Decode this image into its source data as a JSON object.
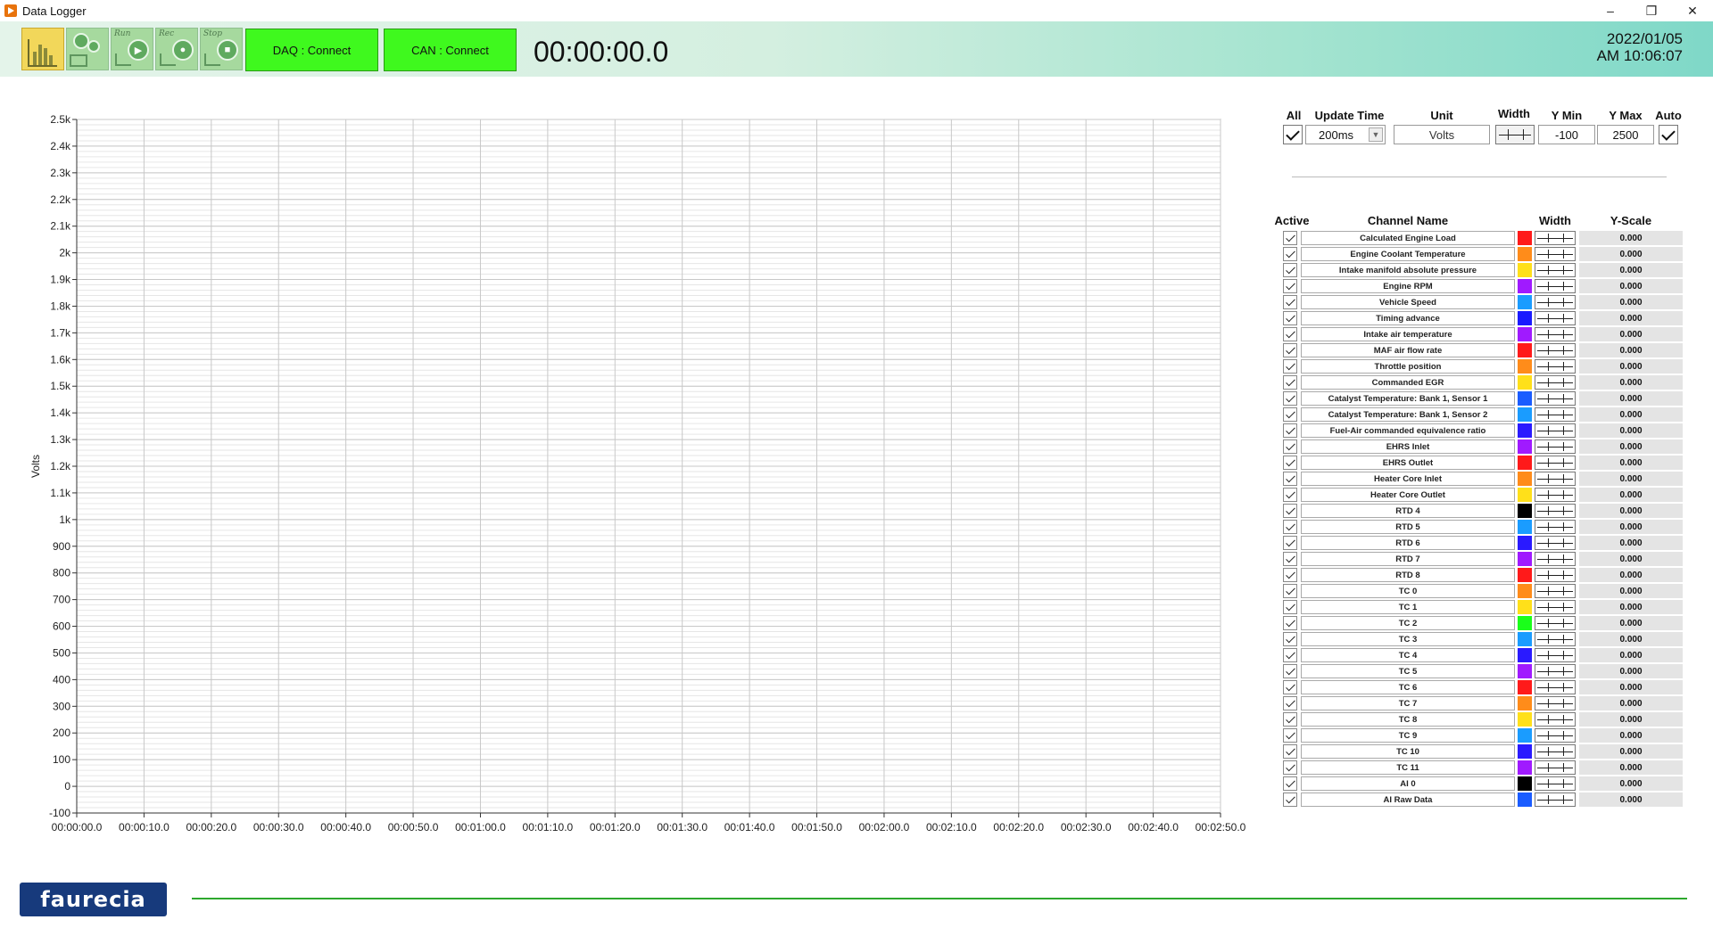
{
  "window": {
    "title": "Data Logger",
    "minimize": "–",
    "restore": "❐",
    "close": "✕"
  },
  "toolbar": {
    "buttons": [
      {
        "label": "",
        "icon": "chart-bars-icon"
      },
      {
        "label": "",
        "icon": "settings-gears-icon"
      },
      {
        "label": "Run",
        "icon": "play-icon"
      },
      {
        "label": "Rec",
        "icon": "record-icon"
      },
      {
        "label": "Stop",
        "icon": "stop-icon"
      }
    ],
    "daq": "DAQ : Connect",
    "can": "CAN : Connect",
    "timer": "00:00:00.0",
    "date": "2022/01/05",
    "time": "AM 10:06:07"
  },
  "controls": {
    "all_label": "All",
    "update_label": "Update Time",
    "update_value": "200ms",
    "unit_label": "Unit",
    "unit_value": "Volts",
    "width_label": "Width",
    "ymin_label": "Y Min",
    "ymin_value": "-100",
    "ymax_label": "Y Max",
    "ymax_value": "2500",
    "auto_label": "Auto"
  },
  "table": {
    "headers": {
      "active": "Active",
      "name": "Channel Name",
      "width": "Width",
      "yscale": "Y-Scale"
    },
    "rows": [
      {
        "name": "Calculated Engine Load",
        "color": "#ff1a1a",
        "yscale": "0.000"
      },
      {
        "name": "Engine Coolant Temperature",
        "color": "#ff8c1a",
        "yscale": "0.000"
      },
      {
        "name": "Intake manifold absolute pressure",
        "color": "#ffe01a",
        "yscale": "0.000"
      },
      {
        "name": "Engine RPM",
        "color": "#a01aff",
        "yscale": "0.000"
      },
      {
        "name": "Vehicle Speed",
        "color": "#1a9cff",
        "yscale": "0.000"
      },
      {
        "name": "Timing advance",
        "color": "#1a1aff",
        "yscale": "0.000"
      },
      {
        "name": "Intake air temperature",
        "color": "#a01aff",
        "yscale": "0.000"
      },
      {
        "name": "MAF air flow rate",
        "color": "#ff1a1a",
        "yscale": "0.000"
      },
      {
        "name": "Throttle position",
        "color": "#ff8c1a",
        "yscale": "0.000"
      },
      {
        "name": "Commanded EGR",
        "color": "#ffe01a",
        "yscale": "0.000"
      },
      {
        "name": "Catalyst Temperature: Bank 1, Sensor 1",
        "color": "#1a5cff",
        "yscale": "0.000"
      },
      {
        "name": "Catalyst Temperature: Bank 1, Sensor 2",
        "color": "#1a9cff",
        "yscale": "0.000"
      },
      {
        "name": "Fuel-Air commanded equivalence ratio",
        "color": "#2a1aff",
        "yscale": "0.000"
      },
      {
        "name": "EHRS Inlet",
        "color": "#a01aff",
        "yscale": "0.000"
      },
      {
        "name": "EHRS Outlet",
        "color": "#ff1a1a",
        "yscale": "0.000"
      },
      {
        "name": "Heater Core Inlet",
        "color": "#ff8c1a",
        "yscale": "0.000"
      },
      {
        "name": "Heater Core Outlet",
        "color": "#ffe01a",
        "yscale": "0.000"
      },
      {
        "name": "RTD 4",
        "color": "#000000",
        "yscale": "0.000"
      },
      {
        "name": "RTD 5",
        "color": "#1a9cff",
        "yscale": "0.000"
      },
      {
        "name": "RTD 6",
        "color": "#2a1aff",
        "yscale": "0.000"
      },
      {
        "name": "RTD 7",
        "color": "#a01aff",
        "yscale": "0.000"
      },
      {
        "name": "RTD 8",
        "color": "#ff1a1a",
        "yscale": "0.000"
      },
      {
        "name": "TC 0",
        "color": "#ff8c1a",
        "yscale": "0.000"
      },
      {
        "name": "TC 1",
        "color": "#ffe01a",
        "yscale": "0.000"
      },
      {
        "name": "TC 2",
        "color": "#1aff1a",
        "yscale": "0.000"
      },
      {
        "name": "TC 3",
        "color": "#1a9cff",
        "yscale": "0.000"
      },
      {
        "name": "TC 4",
        "color": "#2a1aff",
        "yscale": "0.000"
      },
      {
        "name": "TC 5",
        "color": "#a01aff",
        "yscale": "0.000"
      },
      {
        "name": "TC 6",
        "color": "#ff1a1a",
        "yscale": "0.000"
      },
      {
        "name": "TC 7",
        "color": "#ff8c1a",
        "yscale": "0.000"
      },
      {
        "name": "TC 8",
        "color": "#ffe01a",
        "yscale": "0.000"
      },
      {
        "name": "TC 9",
        "color": "#1a9cff",
        "yscale": "0.000"
      },
      {
        "name": "TC 10",
        "color": "#2a1aff",
        "yscale": "0.000"
      },
      {
        "name": "TC 11",
        "color": "#a01aff",
        "yscale": "0.000"
      },
      {
        "name": "AI 0",
        "color": "#000000",
        "yscale": "0.000"
      },
      {
        "name": "AI Raw Data",
        "color": "#1a5cff",
        "yscale": "0.000"
      }
    ]
  },
  "chart_data": {
    "type": "line",
    "title": "",
    "xlabel": "",
    "ylabel": "Volts",
    "ylim": [
      -100,
      2500
    ],
    "yticks": [
      -100,
      0,
      100,
      200,
      300,
      400,
      500,
      600,
      700,
      800,
      900,
      1000,
      1100,
      1200,
      1300,
      1400,
      1500,
      1600,
      1700,
      1800,
      1900,
      2000,
      2100,
      2200,
      2300,
      2400,
      2500
    ],
    "ytick_labels": [
      "-100",
      "0",
      "100",
      "200",
      "300",
      "400",
      "500",
      "600",
      "700",
      "800",
      "900",
      "1k",
      "1.1k",
      "1.2k",
      "1.3k",
      "1.4k",
      "1.5k",
      "1.6k",
      "1.7k",
      "1.8k",
      "1.9k",
      "2k",
      "2.1k",
      "2.2k",
      "2.3k",
      "2.4k",
      "2.5k"
    ],
    "xticks": [
      "00:00:00.0",
      "00:00:10.0",
      "00:00:20.0",
      "00:00:30.0",
      "00:00:40.0",
      "00:00:50.0",
      "00:01:00.0",
      "00:01:10.0",
      "00:01:20.0",
      "00:01:30.0",
      "00:01:40.0",
      "00:01:50.0",
      "00:02:00.0",
      "00:02:10.0",
      "00:02:20.0",
      "00:02:30.0",
      "00:02:40.0",
      "00:02:50.0"
    ],
    "grid": true,
    "series": []
  },
  "footer": {
    "logo": "faurecia"
  }
}
